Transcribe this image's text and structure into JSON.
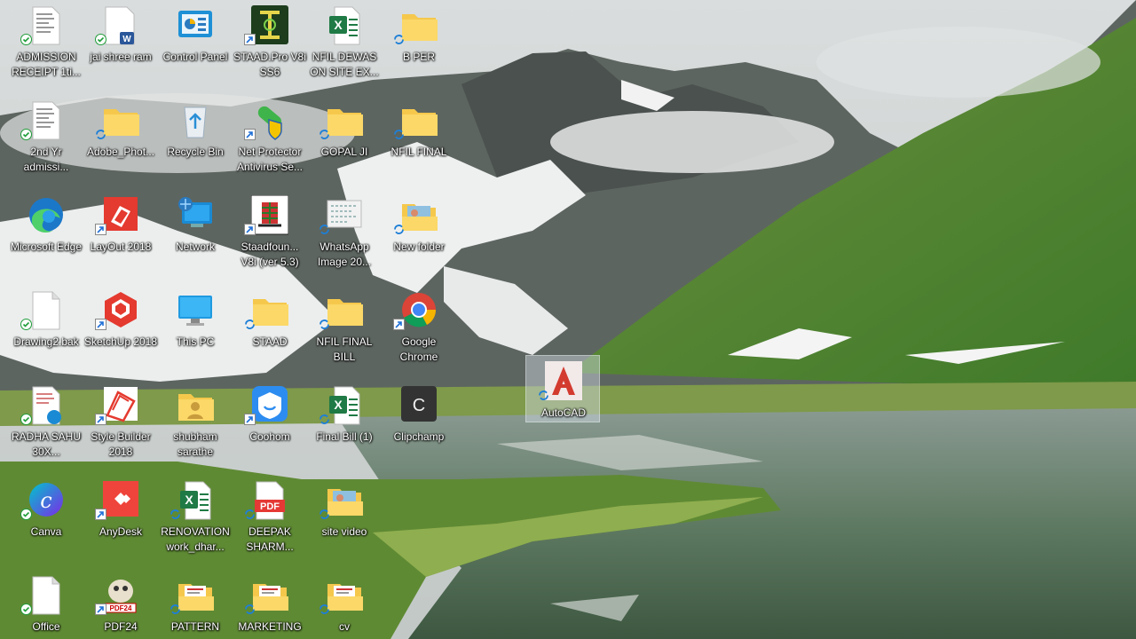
{
  "desktop": {
    "icons": [
      {
        "id": "admission-receipt",
        "label": "ADMISSION RECEIPT 1ti...",
        "type": "doc-form",
        "badge": "sync-ok"
      },
      {
        "id": "jai-shree-ram",
        "label": "jai shree ram",
        "type": "word-doc",
        "badge": "sync-ok"
      },
      {
        "id": "control-panel",
        "label": "Control Panel",
        "type": "control-panel"
      },
      {
        "id": "staad-pro",
        "label": "STAAD.Pro V8i SS6",
        "type": "staad",
        "badge": "shortcut"
      },
      {
        "id": "nfil-dewas",
        "label": "NFIL DEWAS ON SITE EX...",
        "type": "excel"
      },
      {
        "id": "b-per",
        "label": "B PER",
        "type": "folder",
        "badge": "sync"
      },
      {
        "id": "2nd-yr",
        "label": "2nd Yr admissi...",
        "type": "doc-form",
        "badge": "sync-ok"
      },
      {
        "id": "adobe-photo",
        "label": "Adobe_Phot...",
        "type": "folder",
        "badge": "sync"
      },
      {
        "id": "recycle-bin",
        "label": "Recycle Bin",
        "type": "recycle"
      },
      {
        "id": "net-protector",
        "label": "Net Protector Antivirus Se...",
        "type": "antivirus",
        "badge": "shortcut"
      },
      {
        "id": "gopal-ji",
        "label": "GOPAL JI",
        "type": "folder",
        "badge": "sync"
      },
      {
        "id": "nfil-final",
        "label": "NFIL FINAL",
        "type": "folder",
        "badge": "sync"
      },
      {
        "id": "ms-edge",
        "label": "Microsoft Edge",
        "type": "edge"
      },
      {
        "id": "layout-2018",
        "label": "LayOut 2018",
        "type": "layout",
        "badge": "shortcut"
      },
      {
        "id": "network",
        "label": "Network",
        "type": "network"
      },
      {
        "id": "staad-foundation",
        "label": "Staadfoun... V8i (ver 5.3)",
        "type": "staad-foundation",
        "badge": "shortcut"
      },
      {
        "id": "whatsapp-image",
        "label": "WhatsApp Image 20...",
        "type": "image",
        "badge": "sync"
      },
      {
        "id": "new-folder",
        "label": "New folder",
        "type": "folder-img",
        "badge": "sync"
      },
      {
        "id": "drawing2",
        "label": "Drawing2.bak",
        "type": "blank",
        "badge": "sync-ok"
      },
      {
        "id": "sketchup",
        "label": "SketchUp 2018",
        "type": "sketchup",
        "badge": "shortcut"
      },
      {
        "id": "this-pc",
        "label": "This PC",
        "type": "monitor"
      },
      {
        "id": "staad-folder",
        "label": "STAAD",
        "type": "folder",
        "badge": "sync"
      },
      {
        "id": "nfil-final-bill",
        "label": "NFIL FINAL BILL",
        "type": "folder",
        "badge": "sync"
      },
      {
        "id": "google-chrome",
        "label": "Google Chrome",
        "type": "chrome",
        "badge": "shortcut"
      },
      {
        "id": "radha-sahu",
        "label": "RADHA SAHU 30X...",
        "type": "edge-doc",
        "badge": "sync-ok"
      },
      {
        "id": "style-builder",
        "label": "Style Builder 2018",
        "type": "stylebuilder",
        "badge": "shortcut"
      },
      {
        "id": "shubham",
        "label": "shubham sarathe",
        "type": "folder-user"
      },
      {
        "id": "coohom",
        "label": "Coohom",
        "type": "coohom",
        "badge": "shortcut"
      },
      {
        "id": "final-bill",
        "label": "Final Bill (1)",
        "type": "excel",
        "badge": "sync"
      },
      {
        "id": "clipchamp",
        "label": "Clipchamp",
        "type": "clipchamp"
      },
      {
        "id": "autocad",
        "label": "AutoCAD",
        "type": "autocad",
        "badge": "sync",
        "selected": true
      },
      {
        "id": "canva",
        "label": "Canva",
        "type": "canva",
        "badge": "sync-ok"
      },
      {
        "id": "anydesk",
        "label": "AnyDesk",
        "type": "anydesk",
        "badge": "shortcut"
      },
      {
        "id": "renovation",
        "label": "RENOVATION work_dhar...",
        "type": "excel",
        "badge": "sync"
      },
      {
        "id": "deepak",
        "label": "DEEPAK SHARM...",
        "type": "pdf",
        "badge": "sync"
      },
      {
        "id": "site-video",
        "label": "site video",
        "type": "folder-img",
        "badge": "sync"
      },
      {
        "id": "office",
        "label": "Office",
        "type": "blank",
        "badge": "sync-ok"
      },
      {
        "id": "pdf24",
        "label": "PDF24",
        "type": "pdf24",
        "badge": "shortcut"
      },
      {
        "id": "pattern",
        "label": "PATTERN",
        "type": "folder-doc",
        "badge": "sync"
      },
      {
        "id": "marketing",
        "label": "MARKETING",
        "type": "folder-doc",
        "badge": "sync"
      },
      {
        "id": "cv",
        "label": "cv",
        "type": "folder-doc",
        "badge": "sync"
      }
    ]
  },
  "partial_labels": {
    "left1": "N",
    "left2": "N",
    "left3": "N"
  },
  "pdf_text": "PDF",
  "pdf24_text": "PDF24",
  "clipchamp_letter": "C",
  "colors": {
    "folder": "#f5c84c",
    "excel": "#1f7a45",
    "word": "#2b579a",
    "sync": "#1e7fd6",
    "ok": "#1f9d3a"
  }
}
